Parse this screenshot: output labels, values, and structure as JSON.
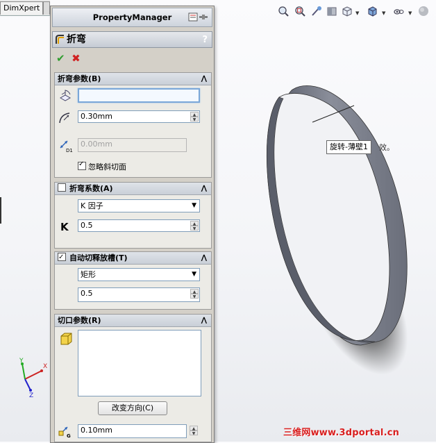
{
  "tabs": {
    "dimxpert": "DimXpert"
  },
  "viewport_toolbar": {
    "icons": [
      "zoom-fit-icon",
      "zoom-area-icon",
      "previous-view-icon",
      "section-view-icon",
      "view-orientation-icon",
      "display-style-icon",
      "hide-show-icon",
      "appearance-icon"
    ]
  },
  "pm": {
    "title": "PropertyManager",
    "feature_name": "折弯",
    "help": "?",
    "ok_symbol": "✔",
    "cancel_symbol": "✖",
    "bend_params": {
      "header": "折弯参数(B)",
      "fixed_face_value": "",
      "radius_value": "0.30mm",
      "thickness_value": "0.00mm",
      "thickness_label": "D1",
      "ignore_bevel_label": "忽略斜切面"
    },
    "bend_allowance": {
      "header": "折弯系数(A)",
      "type_value": "K 因子",
      "k_label": "K",
      "k_value": "0.5"
    },
    "auto_relief": {
      "header": "自动切释放槽(T)",
      "type_value": "矩形",
      "ratio_value": "0.5"
    },
    "rip_params": {
      "header": "切口参数(R)",
      "change_direction_label": "改变方向(C)",
      "gap_value": "0.10mm",
      "gap_label": "G"
    }
  },
  "tooltip": {
    "text": "旋转-薄壁1",
    "tail": "效。"
  },
  "triad": {
    "x": "X",
    "y": "Y",
    "z": "Z"
  },
  "watermark": "三维网www.3dportal.cn",
  "colors": {
    "model": "#7b7f8c",
    "panel": "#d4d0c8",
    "accent_red": "#d91f1f"
  }
}
